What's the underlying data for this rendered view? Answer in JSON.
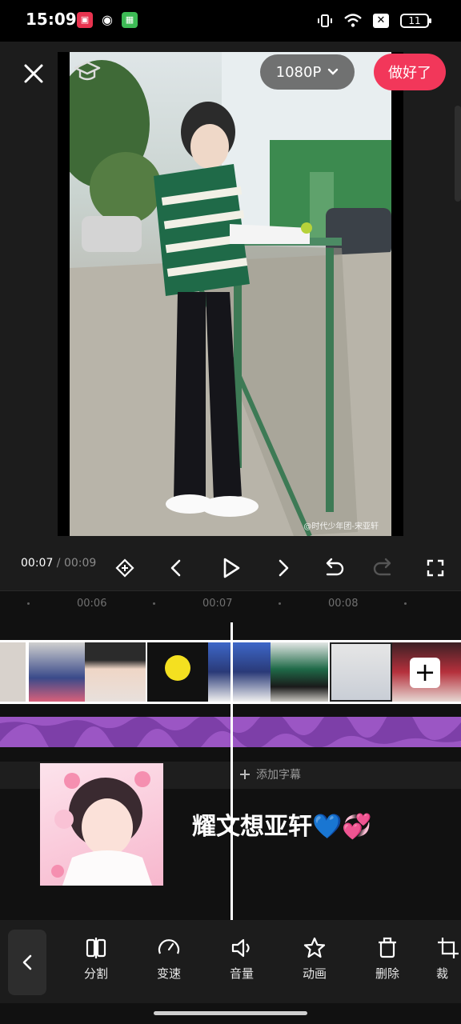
{
  "status_bar": {
    "time": "15:09",
    "battery": "11"
  },
  "preview": {
    "resolution_label": "1080P",
    "done_label": "做好了",
    "watermark": "@时代少年团-宋亚轩"
  },
  "playback": {
    "current_time": "00:07",
    "separator": " / ",
    "total_time": "00:09"
  },
  "timeline": {
    "ruler_ticks": [
      "00:06",
      "00:07",
      "00:08"
    ],
    "add_subtitle_label": "添加字幕",
    "text_overlay": "耀文想亚轩💙💞",
    "add_clip_symbol": "+"
  },
  "toolbar": {
    "items": [
      {
        "label": "分割",
        "icon": "split-icon"
      },
      {
        "label": "变速",
        "icon": "speed-icon"
      },
      {
        "label": "音量",
        "icon": "volume-icon"
      },
      {
        "label": "动画",
        "icon": "animation-icon"
      },
      {
        "label": "删除",
        "icon": "delete-icon"
      },
      {
        "label": "裁",
        "icon": "crop-icon"
      }
    ]
  },
  "colors": {
    "accent": "#f2375a",
    "audio_track": "#9b56c4"
  }
}
